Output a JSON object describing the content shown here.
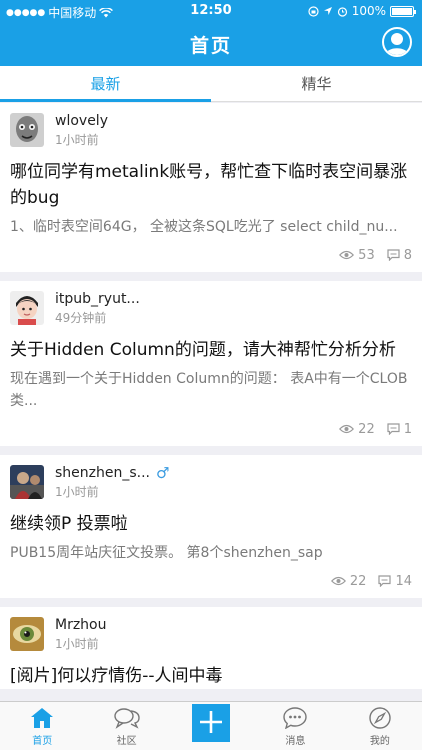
{
  "status_bar": {
    "carrier": "中国移动",
    "time": "12:50",
    "battery": "100%"
  },
  "nav": {
    "title": "首页"
  },
  "tabs": [
    {
      "label": "最新",
      "active": true
    },
    {
      "label": "精华",
      "active": false
    }
  ],
  "posts": [
    {
      "author": "wlovely",
      "time": "1小时前",
      "title": "哪位同学有metalink账号，帮忙查下临时表空间暴涨的bug",
      "excerpt": "1、临时表空间64G，  全被这条SQL吃光了  select child_nu...",
      "views": "53",
      "comments": "8",
      "gender": ""
    },
    {
      "author": "itpub_ryut...",
      "time": "49分钟前",
      "title": "关于Hidden Column的问题，请大神帮忙分析分析",
      "excerpt": "现在遇到一个关于Hidden Column的问题：    表A中有一个CLOB类...",
      "views": "22",
      "comments": "1",
      "gender": ""
    },
    {
      "author": "shenzhen_s...",
      "time": "1小时前",
      "title": "继续领P 投票啦",
      "excerpt": "PUB15周年站庆征文投票。  第8个shenzhen_sap",
      "views": "22",
      "comments": "14",
      "gender": "♂"
    },
    {
      "author": "Mrzhou",
      "time": "1小时前",
      "title": "[阅片]何以疗情伤--人间中毒",
      "excerpt": "",
      "views": "",
      "comments": "",
      "gender": ""
    }
  ],
  "bottom_nav": [
    {
      "label": "首页",
      "icon": "home-icon",
      "active": true
    },
    {
      "label": "社区",
      "icon": "community-icon",
      "active": false
    },
    {
      "label": "",
      "icon": "plus-icon",
      "active": false
    },
    {
      "label": "消息",
      "icon": "message-icon",
      "active": false
    },
    {
      "label": "我的",
      "icon": "compass-icon",
      "active": false
    }
  ],
  "colors": {
    "accent": "#1aa0e6",
    "background": "#efeff4",
    "muted_text": "#999999"
  }
}
